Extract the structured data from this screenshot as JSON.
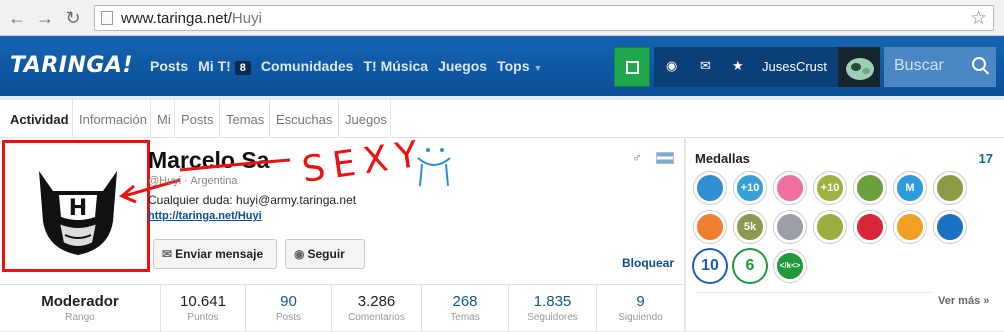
{
  "browser": {
    "url_host": "www.taringa.net/",
    "url_path": "Huyi"
  },
  "site": {
    "logo": "TARINGA!",
    "nav": [
      {
        "label": "Posts"
      },
      {
        "label": "Mi T!",
        "badge": "8"
      },
      {
        "label": "Comunidades"
      },
      {
        "label": "T! Música"
      },
      {
        "label": "Juegos"
      },
      {
        "label": "Tops"
      }
    ],
    "username": "JusesCrust",
    "search_placeholder": "Buscar"
  },
  "tabs": [
    "Actividad",
    "Información",
    "Mi",
    "Posts",
    "Temas",
    "Escuchas",
    "Juegos"
  ],
  "profile": {
    "name": "Marcelo Sa",
    "handle": "@Huyi · Argentina",
    "note": "Cualquier duda: huyi@army.taringa.net",
    "link": "http://taringa.net/Huyi",
    "send_message": "Enviar mensaje",
    "follow": "Seguir",
    "block": "Bloquear",
    "annotation": "SEXY"
  },
  "stats": [
    {
      "value": "Moderador",
      "label": "Rango"
    },
    {
      "value": "10.641",
      "label": "Puntos"
    },
    {
      "value": "90",
      "label": "Posts"
    },
    {
      "value": "3.286",
      "label": "Comentarios"
    },
    {
      "value": "268",
      "label": "Temas"
    },
    {
      "value": "1.835",
      "label": "Seguidores"
    },
    {
      "value": "9",
      "label": "Siguiendo"
    }
  ],
  "medals": {
    "title": "Medallas",
    "count": "17",
    "more": "Ver más »",
    "items": [
      {
        "icon": "book-medal-icon",
        "color": "#2f8fd2",
        "text": ""
      },
      {
        "icon": "plus10-medal-icon",
        "color": "#38a0d8",
        "text": "+10"
      },
      {
        "icon": "pink-face-medal-icon",
        "color": "#ef6fa0",
        "text": ""
      },
      {
        "icon": "plus10-gold-medal-icon",
        "color": "#9cb340",
        "text": "+10"
      },
      {
        "icon": "eye-medal-icon",
        "color": "#6aa13d",
        "text": ""
      },
      {
        "icon": "m-medal-icon",
        "color": "#2e9be0",
        "text": "M"
      },
      {
        "icon": "trophy-medal-icon",
        "color": "#8a9a45",
        "text": ""
      },
      {
        "icon": "orange-face-medal-icon",
        "color": "#f08030",
        "text": ""
      },
      {
        "icon": "5k-medal-icon",
        "color": "#8b9a50",
        "text": "5k"
      },
      {
        "icon": "user-medal-icon",
        "color": "#9aa0a6",
        "text": ""
      },
      {
        "icon": "trophy-olive-medal-icon",
        "color": "#9aae3f",
        "text": ""
      },
      {
        "icon": "pink-splash-medal-icon",
        "color": "#d8253a",
        "text": ""
      },
      {
        "icon": "bird-medal-icon",
        "color": "#f2a024",
        "text": ""
      },
      {
        "icon": "creature-medal-icon",
        "color": "#1b72c4",
        "text": ""
      },
      {
        "icon": "10-medal-icon",
        "color": "#ffffff",
        "text": "10"
      },
      {
        "icon": "6-medal-icon",
        "color": "#ffffff",
        "text": "6"
      },
      {
        "icon": "code-medal-icon",
        "color": "#1f9a3a",
        "text": "</k<>"
      }
    ]
  }
}
